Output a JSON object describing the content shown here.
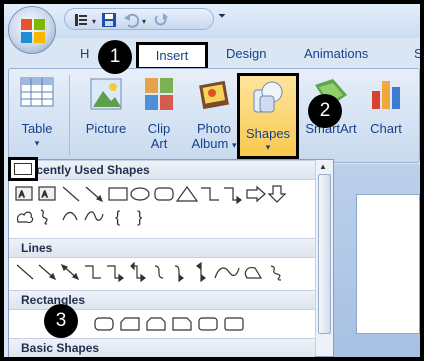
{
  "tabs": {
    "home_fragment": "H",
    "insert": "Insert",
    "design": "Design",
    "animations": "Animations",
    "slide_show_fragment": "S"
  },
  "ribbon": {
    "table": "Table",
    "picture": "Picture",
    "clip_art": [
      "Clip",
      "Art"
    ],
    "photo_album": [
      "Photo",
      "Album"
    ],
    "shapes": "Shapes",
    "smartart": "SmartArt",
    "chart": "Chart"
  },
  "callouts": [
    "1",
    "2",
    "3"
  ],
  "shapes_gallery": {
    "recently_used": "Recently Used Shapes",
    "lines": "Lines",
    "rectangles": "Rectangles",
    "basic_shapes": "Basic Shapes"
  },
  "colors": {
    "ribbon_text": "#15428b",
    "shapes_highlight": "#f9c84f"
  }
}
